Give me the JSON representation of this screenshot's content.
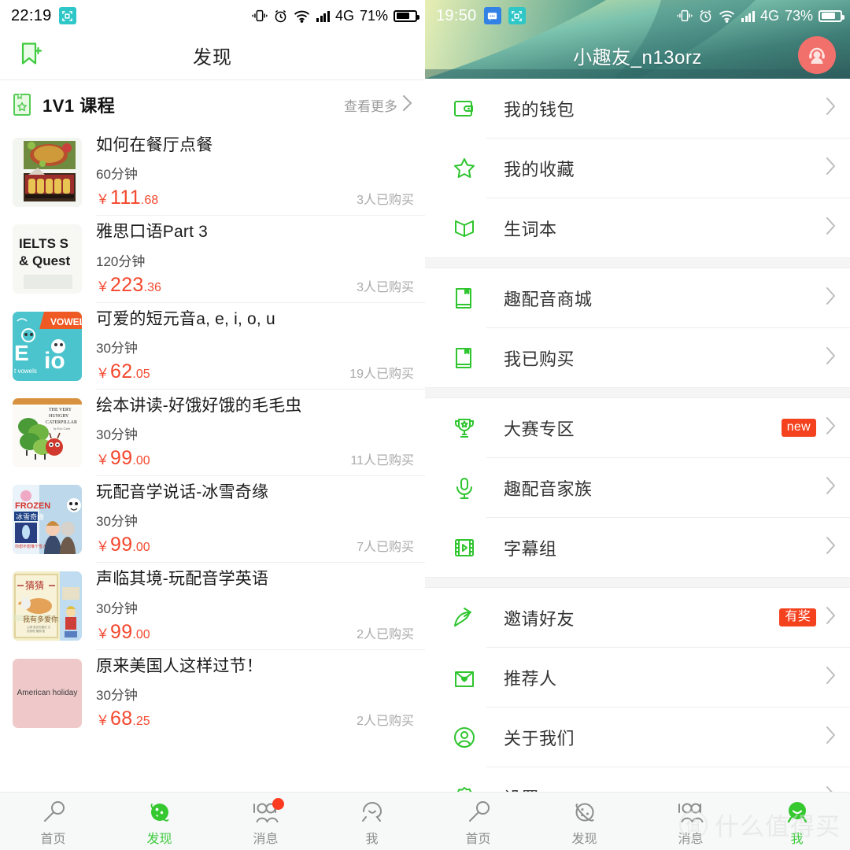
{
  "left": {
    "status": {
      "time": "22:19",
      "badge_icon": "screenshot-icon",
      "vibrate_icon": "vibrate-icon",
      "alarm_icon": "alarm-icon",
      "wifi_icon": "wifi-icon",
      "signal_icon": "signal-bars-icon",
      "network": "4G",
      "battery": "71%"
    },
    "appbar": {
      "title": "发现",
      "left_icon": "bookmark-add-icon"
    },
    "section": {
      "icon": "course-book-icon",
      "title": "1V1 课程",
      "more_label": "查看更多",
      "more_icon": "chevron-right-icon"
    },
    "courses": [
      {
        "thumb": "restaurant-food-thumbnail",
        "title": "如何在餐厅点餐",
        "duration": "60分钟",
        "currency": "￥",
        "price_int": "111",
        "price_dec": ".68",
        "buyers": "3人已购买"
      },
      {
        "thumb": "ielts-speaking-thumbnail",
        "title": "雅思口语Part 3",
        "duration": "120分钟",
        "currency": "￥",
        "price_int": "223",
        "price_dec": ".36",
        "buyers": "3人已购买"
      },
      {
        "thumb": "vowels-thumbnail",
        "title": "可爱的短元音a, e, i, o, u",
        "duration": "30分钟",
        "currency": "￥",
        "price_int": "62",
        "price_dec": ".05",
        "buyers": "19人已购买"
      },
      {
        "thumb": "hungry-caterpillar-thumbnail",
        "title": "绘本讲读-好饿好饿的毛毛虫",
        "duration": "30分钟",
        "currency": "￥",
        "price_int": "99",
        "price_dec": ".00",
        "buyers": "11人已购买"
      },
      {
        "thumb": "frozen-thumbnail",
        "title": "玩配音学说话-冰雪奇缘",
        "duration": "30分钟",
        "currency": "￥",
        "price_int": "99",
        "price_dec": ".00",
        "buyers": "7人已购买"
      },
      {
        "thumb": "guess-how-much-thumbnail",
        "title": "声临其境-玩配音学英语",
        "duration": "30分钟",
        "currency": "￥",
        "price_int": "99",
        "price_dec": ".00",
        "buyers": "2人已购买"
      },
      {
        "thumb": "american-holiday-thumbnail",
        "thumb_text": "American holiday",
        "title": "原来美国人这样过节！",
        "duration": "30分钟",
        "currency": "￥",
        "price_int": "68",
        "price_dec": ".25",
        "buyers": "2人已购买"
      }
    ],
    "tabs": [
      {
        "label": "首页",
        "icon": "microphone-icon",
        "active": false,
        "badge": false
      },
      {
        "label": "发现",
        "icon": "planet-icon",
        "active": true,
        "badge": false
      },
      {
        "label": "消息",
        "icon": "people-icon",
        "active": false,
        "badge": true
      },
      {
        "label": "我",
        "icon": "person-icon",
        "active": false,
        "badge": false
      }
    ]
  },
  "right": {
    "status": {
      "time": "19:50",
      "badge_icon": "sms-icon",
      "badge_icon2": "screenshot-icon",
      "vibrate_icon": "vibrate-icon",
      "alarm_icon": "alarm-icon",
      "wifi_icon": "wifi-icon",
      "signal_icon": "signal-bars-icon",
      "network": "4G",
      "battery": "73%"
    },
    "header": {
      "username": "小趣友_n13orz",
      "avatar_icon": "headphone-person-avatar"
    },
    "menu_groups": [
      {
        "items": [
          {
            "label": "我的钱包",
            "icon": "wallet-icon",
            "tag": ""
          },
          {
            "label": "我的收藏",
            "icon": "star-icon",
            "tag": ""
          },
          {
            "label": "生词本",
            "icon": "open-book-icon",
            "tag": ""
          }
        ]
      },
      {
        "items": [
          {
            "label": "趣配音商城",
            "icon": "book-icon",
            "tag": ""
          },
          {
            "label": "我已购买",
            "icon": "book-icon",
            "tag": ""
          }
        ]
      },
      {
        "items": [
          {
            "label": "大赛专区",
            "icon": "trophy-icon",
            "tag": "new"
          },
          {
            "label": "趣配音家族",
            "icon": "microphone-icon",
            "tag": ""
          },
          {
            "label": "字幕组",
            "icon": "film-play-icon",
            "tag": ""
          }
        ]
      },
      {
        "items": [
          {
            "label": "邀请好友",
            "icon": "share-arrow-icon",
            "tag": "有奖"
          },
          {
            "label": "推荐人",
            "icon": "envelope-heart-icon",
            "tag": ""
          },
          {
            "label": "关于我们",
            "icon": "user-circle-icon",
            "tag": ""
          },
          {
            "label": "设置",
            "icon": "gear-icon",
            "tag": ""
          }
        ]
      }
    ],
    "tabs": [
      {
        "label": "首页",
        "icon": "microphone-icon",
        "active": false,
        "badge": false
      },
      {
        "label": "发现",
        "icon": "planet-icon",
        "active": false,
        "badge": false
      },
      {
        "label": "消息",
        "icon": "people-icon",
        "active": false,
        "badge": false
      },
      {
        "label": "我",
        "icon": "person-icon",
        "active": true,
        "badge": false
      }
    ]
  },
  "watermark": {
    "mark": "值",
    "text": "什么值得买"
  },
  "colors": {
    "accent_green": "#3dcb3d",
    "price_red": "#f4472d",
    "tag_red": "#f4421f",
    "header_teal": "#4b8a80"
  }
}
